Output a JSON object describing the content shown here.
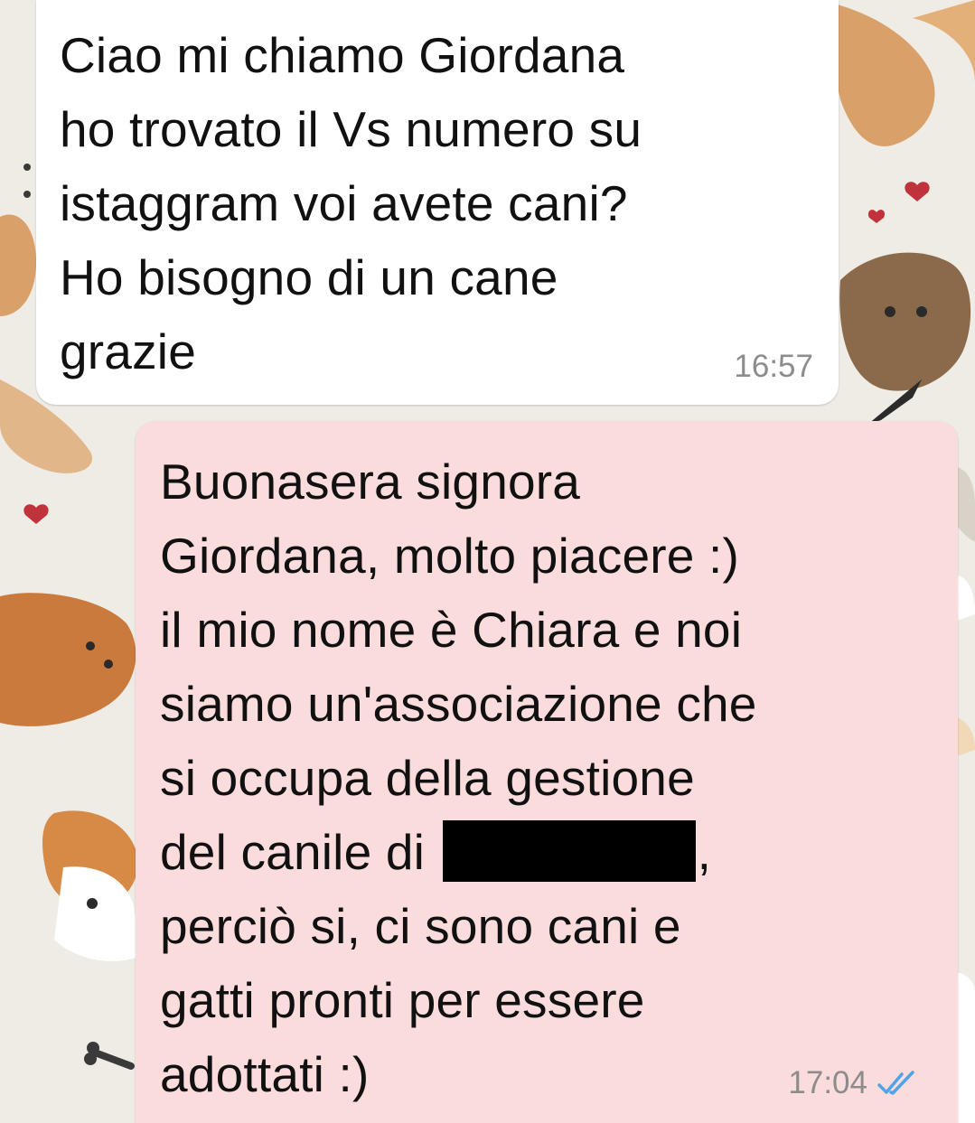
{
  "conversation": {
    "incoming": {
      "text_lines": [
        "Ciao mi chiamo Giordana",
        "ho trovato il Vs numero su",
        "istaggram voi avete cani?",
        "Ho bisogno di un cane",
        "grazie"
      ],
      "time": "16:57",
      "bg_color": "#ffffff"
    },
    "outgoing": {
      "text_before_redaction": "Buonasera signora\nGiordana, molto piacere :)\nil mio nome è Chiara e noi\nsiamo un'associazione che\nsi occupa della gestione\ndel canile di ",
      "text_after_redaction": ",\nperciò si, ci sono cani e\ngatti pronti per essere\nadottati :)",
      "time": "17:04",
      "status_icon": "double-check-read-icon",
      "bg_color": "#fbdcdc",
      "tick_color": "#4fa3e8"
    }
  },
  "wallpaper": {
    "theme": "dogs",
    "base_color": "#efece6"
  }
}
